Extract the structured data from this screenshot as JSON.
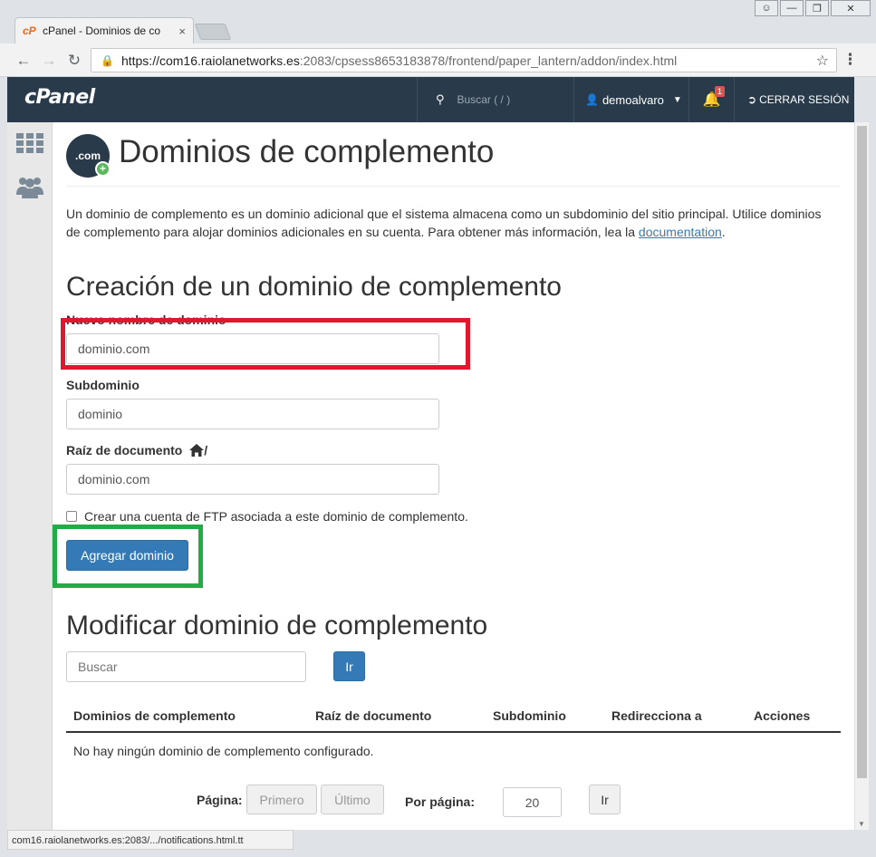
{
  "browser": {
    "tab_title": "cPanel - Dominios de co",
    "tab_close": "×",
    "favicon": "cP",
    "url_scheme_host": "https://com16.raiolanetworks.es",
    "url_rest": ":2083/cpsess8653183878/frontend/paper_lantern/addon/index.html",
    "status_text": "com16.raiolanetworks.es:2083/.../notifications.html.tt"
  },
  "header": {
    "logo": "cPanel",
    "search_placeholder": "Buscar ( / )",
    "username": "demoalvaro",
    "notification_count": "1",
    "logout_label": "CERRAR SESIÓN"
  },
  "page": {
    "icon_text": ".com",
    "title": "Dominios de complemento",
    "intro_text": "Un dominio de complemento es un dominio adicional que el sistema almacena como un subdominio del sitio principal. Utilice dominios de complemento para alojar dominios adicionales en su cuenta. Para obtener más información, lea la ",
    "intro_link": "documentation",
    "intro_end": "."
  },
  "create": {
    "heading": "Creación de un dominio de complemento",
    "new_domain_label": "Nuevo nombre de dominio",
    "new_domain_value": "dominio.com",
    "subdomain_label": "Subdominio",
    "subdomain_value": "dominio",
    "docroot_label": "Raíz de documento",
    "docroot_suffix": "/",
    "docroot_value": "dominio.com",
    "ftp_checkbox_label": "Crear una cuenta de FTP asociada a este dominio de complemento.",
    "submit_label": "Agregar dominio"
  },
  "modify": {
    "heading": "Modificar dominio de complemento",
    "search_placeholder": "Buscar",
    "go_label": "Ir",
    "columns": [
      "Dominios de complemento",
      "Raíz de documento",
      "Subdominio",
      "Redirecciona a",
      "Acciones"
    ],
    "empty_message": "No hay ningún dominio de complemento configurado."
  },
  "pagination": {
    "page_label": "Página:",
    "first_label": "Primero",
    "last_label": "Último",
    "per_page_label": "Por página:",
    "per_page_value": "20",
    "go_label": "Ir"
  },
  "colors": {
    "header_bg": "#293a4a",
    "primary": "#337ab7",
    "highlight_red": "#e0182d",
    "highlight_green": "#22ab47"
  }
}
